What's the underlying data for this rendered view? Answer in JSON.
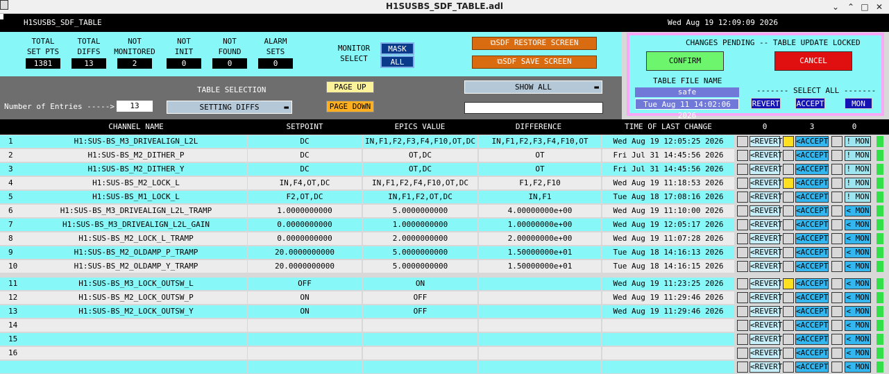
{
  "window": {
    "title": "H1SUSBS_SDF_TABLE.adl"
  },
  "header": {
    "screen_name": "H1SUSBS_SDF_TABLE",
    "datetime": "Wed Aug 19 12:09:09 2026"
  },
  "stats": [
    {
      "label1": "TOTAL",
      "label2": "SET PTS",
      "value": "1381"
    },
    {
      "label1": "TOTAL",
      "label2": "DIFFS",
      "value": "13"
    },
    {
      "label1": "NOT",
      "label2": "MONITORED",
      "value": "2"
    },
    {
      "label1": "NOT",
      "label2": "INIT",
      "value": "0"
    },
    {
      "label1": "NOT",
      "label2": "FOUND",
      "value": "0"
    },
    {
      "label1": "ALARM",
      "label2": "SETS",
      "value": "0"
    }
  ],
  "monitor": {
    "label1": "MONITOR",
    "label2": "SELECT",
    "mask": "MASK",
    "all": "ALL"
  },
  "buttons": {
    "restore": "⧉SDF RESTORE SCREEN",
    "save": "⧉SDF SAVE SCREEN",
    "page_up": "PAGE UP",
    "page_down": "PAGE DOWN",
    "confirm": "CONFIRM",
    "cancel": "CANCEL",
    "revert_all": "REVERT",
    "accept_all": "ACCEPT",
    "mon_all": "MON"
  },
  "table_selection": {
    "label": "TABLE SELECTION",
    "value": "SETTING DIFFS",
    "entries_label": "Number of Entries ----->",
    "entries_value": "13",
    "show_value": "SHOW ALL",
    "filter_value": ""
  },
  "pending": {
    "message": "CHANGES PENDING -- TABLE UPDATE LOCKED",
    "file_label": "TABLE FILE NAME",
    "file_name": "safe",
    "file_time": "Tue Aug 11 14:02:06 2026",
    "select_all_label": "------- SELECT ALL -------"
  },
  "columns": {
    "channel": "CHANNEL NAME",
    "setpoint": "SETPOINT",
    "epics": "EPICS VALUE",
    "difference": "DIFFERENCE",
    "time": "TIME OF LAST CHANGE",
    "count_revert": "0",
    "count_accept": "3",
    "count_mon": "0"
  },
  "rows": [
    {
      "n": "1",
      "ch": "H1:SUS-BS_M3_DRIVEALIGN_L2L",
      "sp": "DC",
      "ev": "IN,F1,F2,F3,F4,F10,OT,DC",
      "df": "IN,F1,F2,F3,F4,F10,OT",
      "tm": "Wed Aug 19 12:05:25 2026",
      "y": true,
      "mon": "! MON"
    },
    {
      "n": "2",
      "ch": "H1:SUS-BS_M2_DITHER_P",
      "sp": "DC",
      "ev": "OT,DC",
      "df": "OT",
      "tm": "Fri Jul 31 14:45:56 2026",
      "y": false,
      "mon": "! MON"
    },
    {
      "n": "3",
      "ch": "H1:SUS-BS_M2_DITHER_Y",
      "sp": "DC",
      "ev": "OT,DC",
      "df": "OT",
      "tm": "Fri Jul 31 14:45:56 2026",
      "y": false,
      "mon": "! MON"
    },
    {
      "n": "4",
      "ch": "H1:SUS-BS_M2_LOCK_L",
      "sp": "IN,F4,OT,DC",
      "ev": "IN,F1,F2,F4,F10,OT,DC",
      "df": "F1,F2,F10",
      "tm": "Wed Aug 19 11:18:53 2026",
      "y": true,
      "mon": "! MON"
    },
    {
      "n": "5",
      "ch": "H1:SUS-BS_M1_LOCK_L",
      "sp": "F2,OT,DC",
      "ev": "IN,F1,F2,OT,DC",
      "df": "IN,F1",
      "tm": "Tue Aug 18 17:08:16 2026",
      "y": false,
      "mon": "! MON"
    },
    {
      "n": "6",
      "ch": "H1:SUS-BS_M3_DRIVEALIGN_L2L_TRAMP",
      "sp": "1.0000000000",
      "ev": "5.0000000000",
      "df": "4.00000000e+00",
      "tm": "Wed Aug 19 11:10:00 2026",
      "y": false,
      "mon": "< MON"
    },
    {
      "n": "7",
      "ch": "H1:SUS-BS_M3_DRIVEALIGN_L2L_GAIN",
      "sp": "0.0000000000",
      "ev": "1.0000000000",
      "df": "1.00000000e+00",
      "tm": "Wed Aug 19 12:05:17 2026",
      "y": false,
      "mon": "< MON"
    },
    {
      "n": "8",
      "ch": "H1:SUS-BS_M2_LOCK_L_TRAMP",
      "sp": "0.0000000000",
      "ev": "2.0000000000",
      "df": "2.00000000e+00",
      "tm": "Wed Aug 19 11:07:28 2026",
      "y": false,
      "mon": "< MON"
    },
    {
      "n": "9",
      "ch": "H1:SUS-BS_M2_OLDAMP_P_TRAMP",
      "sp": "20.0000000000",
      "ev": "5.0000000000",
      "df": "1.50000000e+01",
      "tm": "Tue Aug 18 14:16:13 2026",
      "y": false,
      "mon": "< MON"
    },
    {
      "n": "10",
      "ch": "H1:SUS-BS_M2_OLDAMP_Y_TRAMP",
      "sp": "20.0000000000",
      "ev": "5.0000000000",
      "df": "1.50000000e+01",
      "tm": "Tue Aug 18 14:16:15 2026",
      "y": false,
      "mon": "< MON"
    },
    {
      "n": "11",
      "ch": "H1:SUS-BS_M3_LOCK_OUTSW_L",
      "sp": "OFF",
      "ev": "ON",
      "df": "",
      "tm": "Wed Aug 19 11:23:25 2026",
      "y": true,
      "mon": "< MON"
    },
    {
      "n": "12",
      "ch": "H1:SUS-BS_M2_LOCK_OUTSW_P",
      "sp": "ON",
      "ev": "OFF",
      "df": "",
      "tm": "Wed Aug 19 11:29:46 2026",
      "y": false,
      "mon": "< MON"
    },
    {
      "n": "13",
      "ch": "H1:SUS-BS_M2_LOCK_OUTSW_Y",
      "sp": "ON",
      "ev": "OFF",
      "df": "",
      "tm": "Wed Aug 19 11:29:46 2026",
      "y": false,
      "mon": "< MON"
    },
    {
      "n": "14",
      "ch": "",
      "sp": "",
      "ev": "",
      "df": "",
      "tm": "",
      "y": false,
      "mon": "< MON"
    },
    {
      "n": "15",
      "ch": "",
      "sp": "",
      "ev": "",
      "df": "",
      "tm": "",
      "y": false,
      "mon": "< MON"
    },
    {
      "n": "16",
      "ch": "",
      "sp": "",
      "ev": "",
      "df": "",
      "tm": "",
      "y": false,
      "mon": "< MON"
    },
    {
      "n": "",
      "ch": "",
      "sp": "",
      "ev": "",
      "df": "",
      "tm": "",
      "y": false,
      "mon": "< MON"
    }
  ],
  "row_labels": {
    "revert": "<REVERT",
    "accept": "<ACCEPT"
  }
}
